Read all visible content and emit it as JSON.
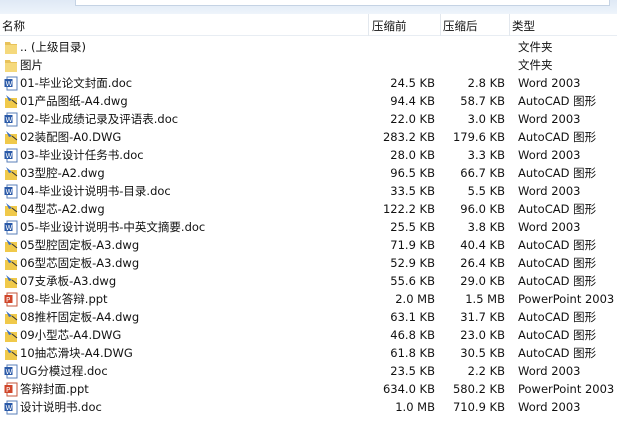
{
  "header": {
    "name": "名称",
    "before": "压缩前",
    "after": "压缩后",
    "type": "类型"
  },
  "rows": [
    {
      "icon": "folder",
      "name": ".. (上级目录)",
      "before": "",
      "after": "",
      "type": "文件夹"
    },
    {
      "icon": "folder",
      "name": "图片",
      "before": "",
      "after": "",
      "type": "文件夹"
    },
    {
      "icon": "word",
      "name": "01-毕业论文封面.doc",
      "before": "24.5 KB",
      "after": "2.8 KB",
      "type": "Word 2003"
    },
    {
      "icon": "dwg",
      "name": "01产品图纸-A4.dwg",
      "before": "94.4 KB",
      "after": "58.7 KB",
      "type": "AutoCAD 图形"
    },
    {
      "icon": "word",
      "name": "02-毕业成绩记录及评语表.doc",
      "before": "22.0 KB",
      "after": "3.0 KB",
      "type": "Word 2003"
    },
    {
      "icon": "dwg",
      "name": "02装配图-A0.DWG",
      "before": "283.2 KB",
      "after": "179.6 KB",
      "type": "AutoCAD 图形"
    },
    {
      "icon": "word",
      "name": "03-毕业设计任务书.doc",
      "before": "28.0 KB",
      "after": "3.3 KB",
      "type": "Word 2003"
    },
    {
      "icon": "dwg",
      "name": "03型腔-A2.dwg",
      "before": "96.5 KB",
      "after": "66.7 KB",
      "type": "AutoCAD 图形"
    },
    {
      "icon": "word",
      "name": "04-毕业设计说明书-目录.doc",
      "before": "33.5 KB",
      "after": "5.5 KB",
      "type": "Word 2003"
    },
    {
      "icon": "dwg",
      "name": "04型芯-A2.dwg",
      "before": "122.2 KB",
      "after": "96.0 KB",
      "type": "AutoCAD 图形"
    },
    {
      "icon": "word",
      "name": "05-毕业设计说明书-中英文摘要.doc",
      "before": "25.5 KB",
      "after": "3.8 KB",
      "type": "Word 2003"
    },
    {
      "icon": "dwg",
      "name": "05型腔固定板-A3.dwg",
      "before": "71.9 KB",
      "after": "40.4 KB",
      "type": "AutoCAD 图形"
    },
    {
      "icon": "dwg",
      "name": "06型芯固定板-A3.dwg",
      "before": "52.9 KB",
      "after": "26.4 KB",
      "type": "AutoCAD 图形"
    },
    {
      "icon": "dwg",
      "name": "07支承板-A3.dwg",
      "before": "55.6 KB",
      "after": "29.0 KB",
      "type": "AutoCAD 图形"
    },
    {
      "icon": "ppt",
      "name": "08-毕业答辩.ppt",
      "before": "2.0 MB",
      "after": "1.5 MB",
      "type": "PowerPoint 2003"
    },
    {
      "icon": "dwg",
      "name": "08推杆固定板-A4.dwg",
      "before": "63.1 KB",
      "after": "31.7 KB",
      "type": "AutoCAD 图形"
    },
    {
      "icon": "dwg",
      "name": "09小型芯-A4.DWG",
      "before": "46.8 KB",
      "after": "23.0 KB",
      "type": "AutoCAD 图形"
    },
    {
      "icon": "dwg",
      "name": "10抽芯滑块-A4.DWG",
      "before": "61.8 KB",
      "after": "30.5 KB",
      "type": "AutoCAD 图形"
    },
    {
      "icon": "word",
      "name": "UG分模过程.doc",
      "before": "23.5 KB",
      "after": "2.2 KB",
      "type": "Word 2003"
    },
    {
      "icon": "ppt",
      "name": "答辩封面.ppt",
      "before": "634.0 KB",
      "after": "580.2 KB",
      "type": "PowerPoint 2003"
    },
    {
      "icon": "word",
      "name": "设计说明书.doc",
      "before": "1.0 MB",
      "after": "710.9 KB",
      "type": "Word 2003"
    }
  ]
}
